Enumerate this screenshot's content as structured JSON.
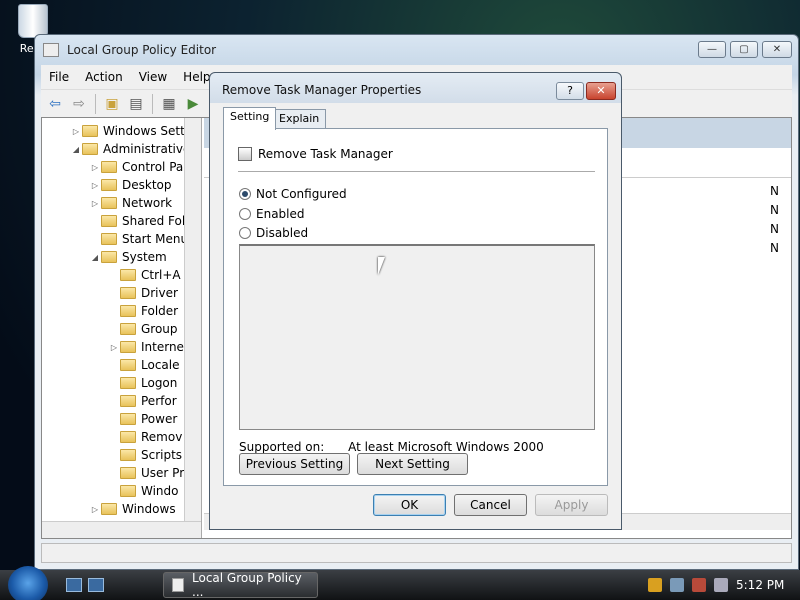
{
  "desktop": {
    "recycle_label": "Recy"
  },
  "window": {
    "title": "Local Group Policy Editor",
    "minimize": "—",
    "maximize": "▢",
    "close": "✕"
  },
  "menu": {
    "items": [
      "File",
      "Action",
      "View",
      "Help"
    ]
  },
  "tree": {
    "items": [
      {
        "label": "Windows Sett",
        "expander": "▷",
        "indent": 0
      },
      {
        "label": "Administrative",
        "expander": "◢",
        "indent": 0
      },
      {
        "label": "Control Pa",
        "expander": "▷",
        "indent": 1
      },
      {
        "label": "Desktop",
        "expander": "▷",
        "indent": 1
      },
      {
        "label": "Network",
        "expander": "▷",
        "indent": 1
      },
      {
        "label": "Shared Fol",
        "expander": "",
        "indent": 1
      },
      {
        "label": "Start Menu",
        "expander": "",
        "indent": 1
      },
      {
        "label": "System",
        "expander": "◢",
        "indent": 1
      },
      {
        "label": "Ctrl+A",
        "expander": "",
        "indent": 2
      },
      {
        "label": "Driver",
        "expander": "",
        "indent": 2
      },
      {
        "label": "Folder",
        "expander": "",
        "indent": 2
      },
      {
        "label": "Group",
        "expander": "",
        "indent": 2
      },
      {
        "label": "Interne",
        "expander": "▷",
        "indent": 2
      },
      {
        "label": "Locale",
        "expander": "",
        "indent": 2
      },
      {
        "label": "Logon",
        "expander": "",
        "indent": 2
      },
      {
        "label": "Perfor",
        "expander": "",
        "indent": 2
      },
      {
        "label": "Power",
        "expander": "",
        "indent": 2
      },
      {
        "label": "Remov",
        "expander": "",
        "indent": 2
      },
      {
        "label": "Scripts",
        "expander": "",
        "indent": 2
      },
      {
        "label": "User Pr",
        "expander": "",
        "indent": 2
      },
      {
        "label": "Windo",
        "expander": "",
        "indent": 2
      },
      {
        "label": "Windows",
        "expander": "▷",
        "indent": 1
      }
    ]
  },
  "right_pane": {
    "rows": [
      "N",
      "N",
      "N",
      "N"
    ]
  },
  "dialog": {
    "title": "Remove Task Manager Properties",
    "help": "?",
    "close": "✕",
    "tabs": [
      "Setting",
      "Explain"
    ],
    "policy_name": "Remove Task Manager",
    "options": [
      {
        "label": "Not Configured",
        "selected": true
      },
      {
        "label": "Enabled",
        "selected": false
      },
      {
        "label": "Disabled",
        "selected": false
      }
    ],
    "supported_label": "Supported on:",
    "supported_value": "At least Microsoft Windows 2000",
    "prev_button": "Previous Setting",
    "next_button": "Next Setting",
    "ok_button": "OK",
    "cancel_button": "Cancel",
    "apply_button": "Apply"
  },
  "taskbar": {
    "task_label": "Local Group Policy ...",
    "clock": "5:12 PM"
  }
}
